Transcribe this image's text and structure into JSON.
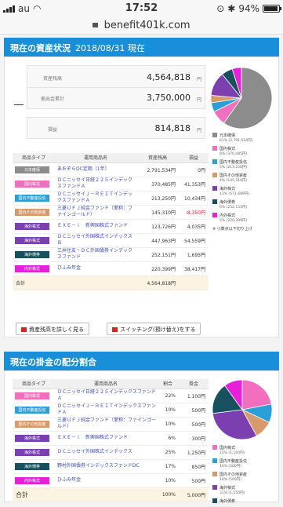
{
  "statusbar": {
    "carrier": "au",
    "time": "17:52",
    "battery": "94%",
    "battery_level": 0.94
  },
  "browser": {
    "url": "benefit401k.com"
  },
  "assets_section": {
    "title": "現在の資産状況",
    "date": "2018/08/31 現在"
  },
  "summary": {
    "balance_label": "資産残高",
    "balance_value": "4,564,818",
    "unit": "円",
    "contrib_label": "拠出金累計",
    "contrib_value": "3,750,000",
    "gain_label": "損益",
    "gain_value": "814,818"
  },
  "assets_table": {
    "headers": [
      "商品タイプ",
      "運用商品名",
      "資産残高",
      "損益"
    ],
    "rows": [
      {
        "type": "元本確保",
        "color": "#8c8c8c",
        "name": "あおぞらDC定期（1年）",
        "balance": "2,791,534円",
        "gain": "0円",
        "neg": false
      },
      {
        "type": "国内株式",
        "color": "#f26fbf",
        "name": "ＤＣニッセイ日経２２５インデックスファンドＡ",
        "balance": "370,485円",
        "gain": "41,353円",
        "neg": false
      },
      {
        "type": "国内不動産投信",
        "color": "#2aa0d6",
        "name": "ＤＣニッセイＪ－ＲＥＩＴインデックスファンドＡ",
        "balance": "213,250円",
        "gain": "10,434円",
        "neg": false
      },
      {
        "type": "国内その他資産",
        "color": "#d99a6a",
        "name": "三菱ＵＦＪ純金ファンド（愛称：ファインゴールド）",
        "balance": "145,310円",
        "gain": "-8,350円",
        "neg": true
      },
      {
        "type": "海外株式",
        "color": "#7b3fb0",
        "name": "ＥＸＥ－ｉ　新興国株式ファンド",
        "balance": "123,726円",
        "gain": "4,035円",
        "neg": false
      },
      {
        "type": "海外株式",
        "color": "#7b3fb0",
        "name": "ＤＣニッセイ外国株式インデックスＢ",
        "balance": "447,963円",
        "gain": "54,559円",
        "neg": false
      },
      {
        "type": "海外債券",
        "color": "#17505f",
        "name": "三井住友・ＤＣ外国債券インデックスファンド",
        "balance": "252,151円",
        "gain": "1,695円",
        "neg": false
      },
      {
        "type": "内外株式",
        "color": "#e620d9",
        "name": "ひふみ年金",
        "balance": "220,399円",
        "gain": "38,417円",
        "neg": false
      }
    ],
    "total_label": "合計",
    "total_value": "4,564,818円"
  },
  "buttons": {
    "detail": "資産残高を詳しく見る",
    "switch": "スイッチング(預け替え)をする"
  },
  "asset_legend": {
    "items": [
      {
        "label": "元本確保",
        "sub": "61% (2,791,534円)",
        "color": "#8c8c8c"
      },
      {
        "label": "国内株式",
        "sub": "8% (370,485円)",
        "color": "#f26fbf"
      },
      {
        "label": "国内不動産投信",
        "sub": "5% (213,250円)",
        "color": "#2aa0d6"
      },
      {
        "label": "国内その他資産",
        "sub": "4% (145,310円)",
        "color": "#d99a6a"
      },
      {
        "label": "海外株式",
        "sub": "13% (571,689円)",
        "color": "#7b3fb0"
      },
      {
        "label": "海外債券",
        "sub": "6% (252,151円)",
        "color": "#17505f"
      },
      {
        "label": "内外株式",
        "sub": "5% (220,399円)",
        "color": "#e620d9"
      }
    ],
    "note": "※ 小数点以下切り上げ"
  },
  "alloc_section": {
    "title": "現在の掛金の配分割合"
  },
  "alloc_table": {
    "headers": [
      "商品タイプ",
      "運用商品名",
      "割合",
      "掛金"
    ],
    "rows": [
      {
        "type": "国内株式",
        "color": "#f26fbf",
        "name": "ＤＣニッセイ日経２２５インデックスファンドＡ",
        "pct": "22%",
        "amount": "1,100円"
      },
      {
        "type": "国内不動産投信",
        "color": "#2aa0d6",
        "name": "ＤＣニッセイＪ－ＲＥＩＴインデックスファンドＡ",
        "pct": "10%",
        "amount": "500円"
      },
      {
        "type": "国内その他資産",
        "color": "#d99a6a",
        "name": "三菱ＵＦＪ純金ファンド（愛称：ファインゴールド）",
        "pct": "10%",
        "amount": "500円"
      },
      {
        "type": "海外株式",
        "color": "#7b3fb0",
        "name": "ＥＸＥ－ｉ　新興国株式ファンド",
        "pct": "6%",
        "amount": "300円"
      },
      {
        "type": "海外株式",
        "color": "#7b3fb0",
        "name": "ＤＣニッセイ外国株式インデックス",
        "pct": "25%",
        "amount": "1,250円"
      },
      {
        "type": "海外債券",
        "color": "#17505f",
        "name": "野村外国債券インデックスファンドDC",
        "pct": "17%",
        "amount": "850円"
      },
      {
        "type": "内外株式",
        "color": "#e620d9",
        "name": "ひふみ年金",
        "pct": "10%",
        "amount": "500円"
      }
    ],
    "total_label": "合計",
    "total_pct": "100%",
    "total_amount": "5,000円"
  },
  "alloc_legend": {
    "items": [
      {
        "label": "国内株式",
        "sub": "22% (1,100円)",
        "color": "#f26fbf"
      },
      {
        "label": "国内不動産投信",
        "sub": "10% (500円)",
        "color": "#2aa0d6"
      },
      {
        "label": "国内その他資産",
        "sub": "10% (500円)",
        "color": "#d99a6a"
      },
      {
        "label": "海外株式",
        "sub": "31% (1,550円)",
        "color": "#7b3fb0"
      },
      {
        "label": "海外債券",
        "sub": "",
        "color": "#17505f"
      }
    ]
  },
  "chart_data": [
    {
      "type": "pie",
      "categories": [
        "元本確保",
        "国内株式",
        "国内不動産投信",
        "国内その他資産",
        "海外株式",
        "海外債券",
        "内外株式"
      ],
      "values": [
        61,
        8,
        5,
        4,
        13,
        6,
        5
      ],
      "colors": [
        "#8c8c8c",
        "#f26fbf",
        "#2aa0d6",
        "#d99a6a",
        "#7b3fb0",
        "#17505f",
        "#e620d9"
      ]
    },
    {
      "type": "pie",
      "categories": [
        "国内株式",
        "国内不動産投信",
        "国内その他資産",
        "海外株式",
        "海外債券",
        "内外株式"
      ],
      "values": [
        22,
        10,
        10,
        31,
        17,
        10
      ],
      "colors": [
        "#f26fbf",
        "#2aa0d6",
        "#d99a6a",
        "#7b3fb0",
        "#17505f",
        "#e620d9"
      ]
    }
  ]
}
